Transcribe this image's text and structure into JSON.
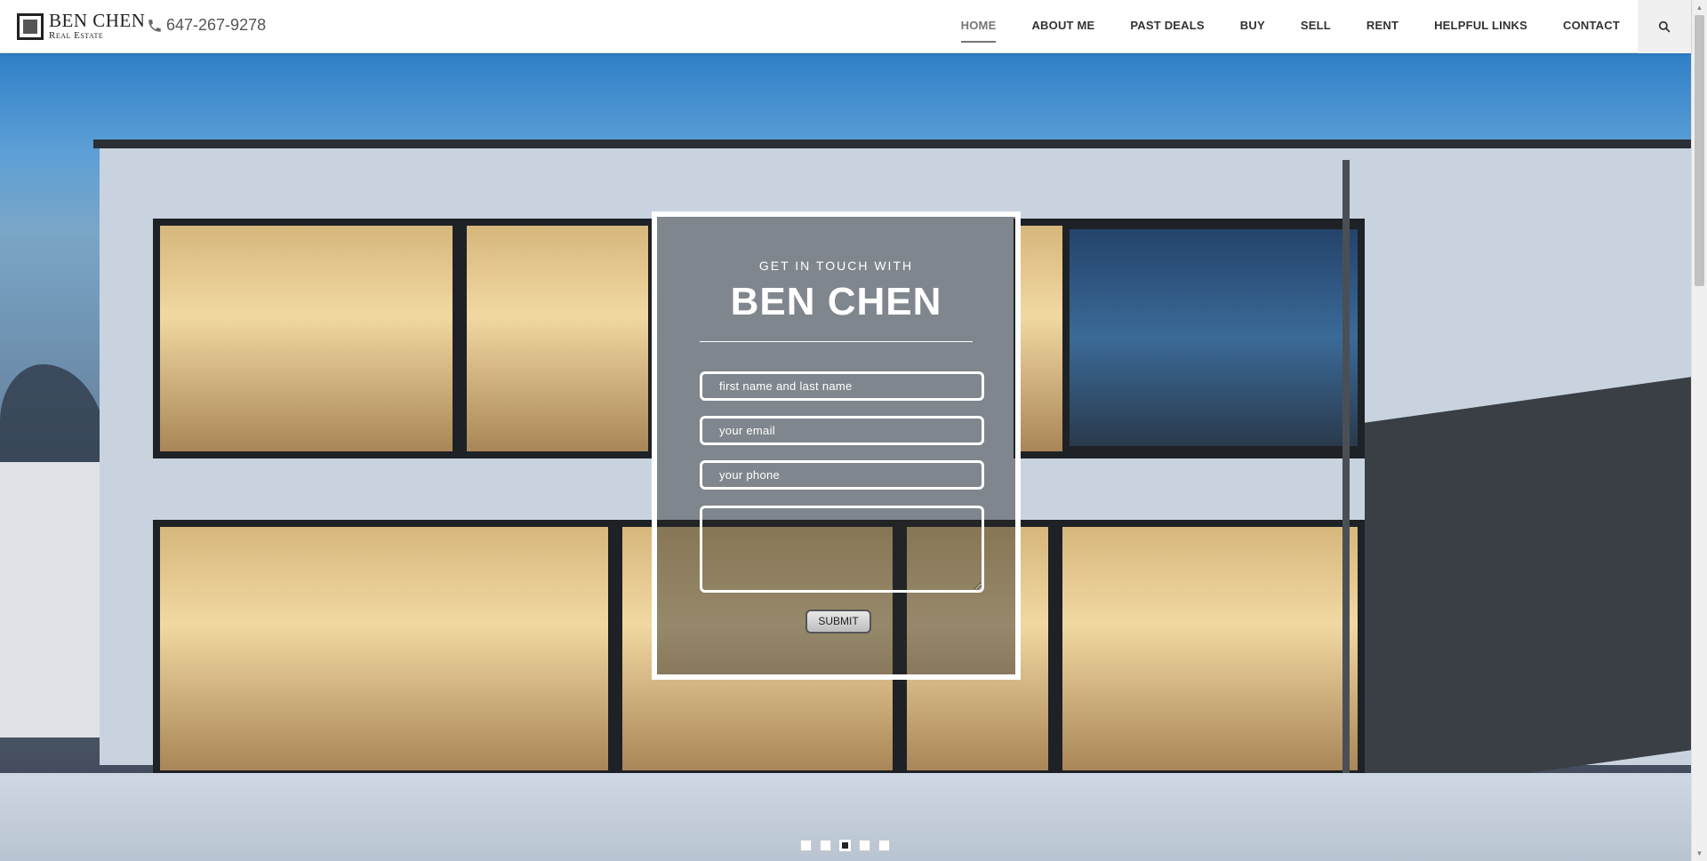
{
  "header": {
    "logo_name": "BEN CHEN",
    "logo_sub": "Real Estate",
    "phone": "647-267-9278",
    "nav": [
      {
        "label": "HOME",
        "active": true
      },
      {
        "label": "ABOUT ME"
      },
      {
        "label": "PAST DEALS"
      },
      {
        "label": "BUY"
      },
      {
        "label": "SELL"
      },
      {
        "label": "RENT"
      },
      {
        "label": "HELPFUL LINKS"
      },
      {
        "label": "CONTACT"
      }
    ],
    "search_icon": "search-icon"
  },
  "form": {
    "subtitle": "GET IN TOUCH WITH",
    "title": "BEN CHEN",
    "name_placeholder": "first name and last name",
    "email_placeholder": "your email",
    "phone_placeholder": "your phone",
    "message_value": "",
    "submit_label": "SUBMIT"
  },
  "slider": {
    "slide_count": 5,
    "active_index": 2
  }
}
